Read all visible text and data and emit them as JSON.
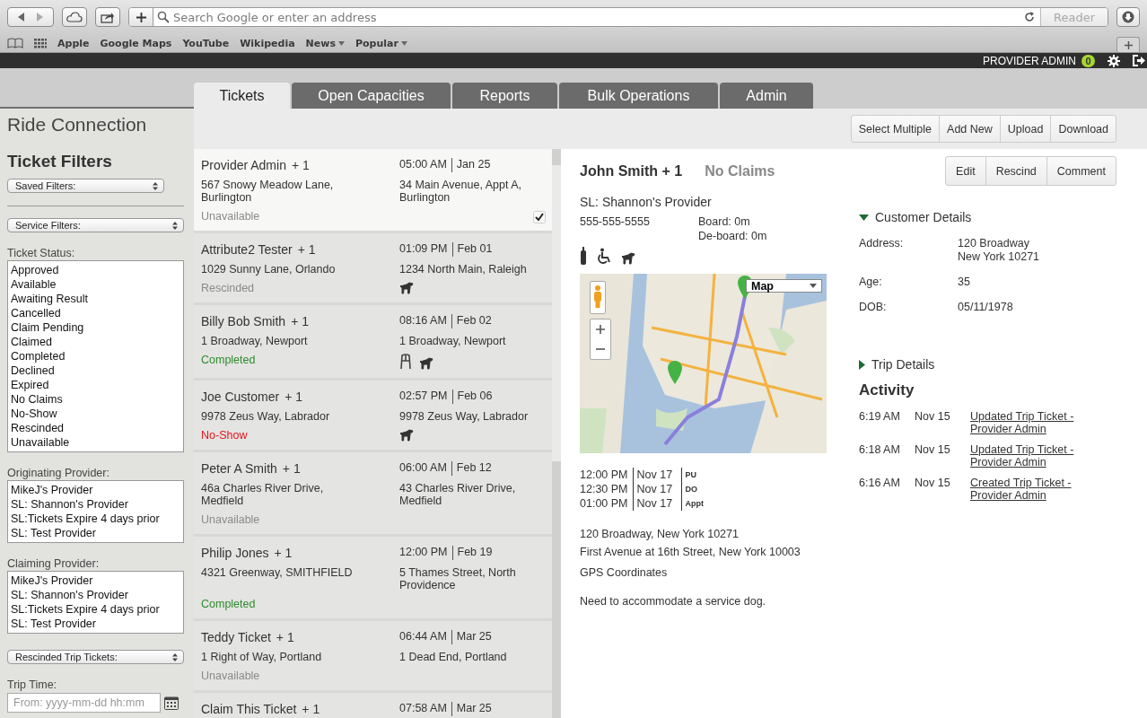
{
  "browser": {
    "address_placeholder": "Search Google or enter an address",
    "reader": {
      "label": "Reader",
      "disabled": true
    },
    "bookmarks": [
      {
        "label": "Apple",
        "has_menu": false
      },
      {
        "label": "Google Maps",
        "has_menu": false
      },
      {
        "label": "YouTube",
        "has_menu": false
      },
      {
        "label": "Wikipedia",
        "has_menu": false
      },
      {
        "label": "News",
        "has_menu": true
      },
      {
        "label": "Popular",
        "has_menu": true
      }
    ]
  },
  "header": {
    "user": "PROVIDER ADMIN",
    "notifications": "0"
  },
  "tabs": [
    {
      "label": "Tickets",
      "selected": true
    },
    {
      "label": "Open Capacities",
      "selected": false
    },
    {
      "label": "Reports",
      "selected": false
    },
    {
      "label": "Bulk Operations",
      "selected": false
    },
    {
      "label": "Admin",
      "selected": false
    }
  ],
  "sidebar": {
    "organization": "Ride Connection",
    "title": "Ticket Filters",
    "saved_filters": "Saved Filters:",
    "service_filters": "Service Filters:",
    "ticket_status": {
      "label": "Ticket Status:",
      "options": [
        "Approved",
        "Available",
        "Awaiting Result",
        "Cancelled",
        "Claim Pending",
        "Claimed",
        "Completed",
        "Declined",
        "Expired",
        "No Claims",
        "No-Show",
        "Rescinded",
        "Unavailable"
      ]
    },
    "originating_provider": {
      "label": "Originating Provider:",
      "options": [
        "MikeJ's Provider",
        "SL: Shannon's Provider",
        "SL:Tickets Expire 4 days prior",
        "SL: Test Provider"
      ]
    },
    "claiming_provider": {
      "label": "Claiming Provider:",
      "options": [
        "MikeJ's Provider",
        "SL: Shannon's Provider",
        "SL:Tickets Expire 4 days prior",
        "SL: Test Provider"
      ]
    },
    "rescinded": "Rescinded Trip Tickets:",
    "trip_time": {
      "label": "Trip Time:",
      "placeholder": "From: yyyy-mm-dd hh:mm"
    }
  },
  "toolbar": [
    "Select Multiple",
    "Add New",
    "Upload",
    "Download"
  ],
  "tickets": [
    {
      "name": "Provider Admin",
      "extra": "+ 1",
      "time": "05:00 AM",
      "date": "Jan 25",
      "pickup": "567 Snowy Meadow Lane, Burlington",
      "dropoff": "34 Main Avenue, Appt A, Burlington",
      "status": "Unavailable",
      "color": "#8a8a8a",
      "selected": true,
      "checked": true
    },
    {
      "name": "Attribute2 Tester",
      "extra": "+ 1",
      "time": "01:09 PM",
      "date": "Feb 01",
      "pickup": "1029 Sunny Lane, Orlando",
      "dropoff": "1234 North Main, Raleigh",
      "status": "Rescinded",
      "color": "#8a8a8a",
      "icons": [
        {
          "kind": "dog"
        }
      ],
      "selected": false,
      "checked": false
    },
    {
      "name": "Billy Bob Smith",
      "extra": "+ 1",
      "time": "08:16 AM",
      "date": "Feb 02",
      "pickup": "1 Broadway, Newport",
      "dropoff": "1 Broadway, Newport",
      "status": "Completed",
      "color": "#2e8b2e",
      "icons": [
        {
          "kind": "walker"
        },
        {
          "kind": "dog"
        }
      ],
      "selected": false,
      "checked": false
    },
    {
      "name": "Joe Customer",
      "extra": "+ 1",
      "time": "02:57 PM",
      "date": "Feb 06",
      "pickup": "9978 Zeus Way, Labrador",
      "dropoff": "9978 Zeus Way, Labrador",
      "status": "No-Show",
      "color": "#e8141e",
      "icons": [
        {
          "kind": "dog"
        }
      ],
      "selected": false,
      "checked": false
    },
    {
      "name": "Peter A Smith",
      "extra": "+ 1",
      "time": "06:00 AM",
      "date": "Feb 12",
      "pickup": "46a Charles River Drive, Medfield",
      "dropoff": "43 Charles River Drive, Medfield",
      "status": "Unavailable",
      "color": "#8a8a8a",
      "selected": false,
      "checked": false
    },
    {
      "name": "Philip Jones",
      "extra": "+ 1",
      "time": "12:00 PM",
      "date": "Feb 19",
      "pickup": "4321 Greenway, SMITHFIELD",
      "dropoff": "5 Thames Street, North Providence",
      "status": "Completed",
      "color": "#2e8b2e",
      "selected": false,
      "checked": false
    },
    {
      "name": "Teddy Ticket",
      "extra": "+ 1",
      "time": "06:44 AM",
      "date": "Mar 25",
      "pickup": "1 Right of Way, Portland",
      "dropoff": "1 Dead End, Portland",
      "status": "Unavailable",
      "color": "#8a8a8a",
      "selected": false,
      "checked": false
    },
    {
      "name": "Claim This Ticket",
      "extra": "+ 1",
      "time": "07:58 AM",
      "date": "Mar 25",
      "selected": false,
      "checked": false
    }
  ],
  "detail": {
    "name": "John Smith + 1",
    "claim_status": "No Claims",
    "actions": [
      "Edit",
      "Rescind",
      "Comment"
    ],
    "provider": "SL: Shannon's Provider",
    "phone": "555-555-5555",
    "board": "Board: 0m",
    "deboard": "De-board: 0m",
    "icons": [
      {
        "kind": "oxygen"
      },
      {
        "kind": "wheelchair"
      },
      {
        "kind": "dog"
      }
    ],
    "map": {
      "type_control": "Map"
    },
    "schedule": [
      {
        "time": "12:00 PM",
        "date": "Nov 17",
        "tag": "PU"
      },
      {
        "time": "12:30 PM",
        "date": "Nov 17",
        "tag": "DO"
      },
      {
        "time": "01:00 PM",
        "date": "Nov 17",
        "tag": "Appt"
      }
    ],
    "pickup_address": "120 Broadway, New York 10271",
    "dropoff_address": "First Avenue at 16th Street, New York 10003",
    "gps": "GPS Coordinates",
    "notes": "Need to accommodate a service dog.",
    "customer_details": {
      "title": "Customer Details",
      "expanded": true,
      "fields": [
        {
          "label": "Address:",
          "value": "120 Broadway\nNew York 10271"
        },
        {
          "label": "Age:",
          "value": "35"
        },
        {
          "label": "DOB:",
          "value": "05/11/1978"
        }
      ]
    },
    "trip_details": {
      "title": "Trip Details",
      "expanded": false
    },
    "activity": {
      "title": "Activity",
      "entries": [
        {
          "time": "6:19 AM",
          "date": "Nov 15",
          "text": "Updated Trip Ticket - Provider Admin"
        },
        {
          "time": "6:18 AM",
          "date": "Nov 15",
          "text": "Updated Trip Ticket - Provider Admin"
        },
        {
          "time": "6:16 AM",
          "date": "Nov 15",
          "text": "Created Trip Ticket - Provider Admin"
        }
      ]
    }
  }
}
